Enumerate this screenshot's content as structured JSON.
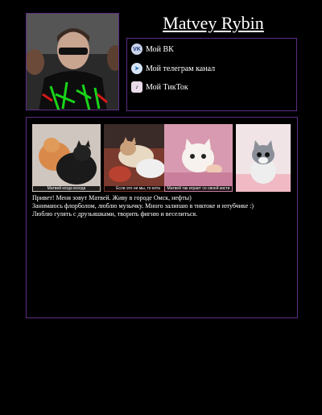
{
  "profile": {
    "name": "Matvey Rybin",
    "avatar_alt": "avatar"
  },
  "links": [
    {
      "label": "Мой ВК",
      "icon": "vk-icon",
      "glyph": "VK"
    },
    {
      "label": "Мой телеграм канал",
      "icon": "telegram-icon",
      "glyph": "➤"
    },
    {
      "label": "Мой ТикТок",
      "icon": "tiktok-icon",
      "glyph": "♪"
    }
  ],
  "gallery": [
    {
      "caption": "Матвей когда всегда"
    },
    {
      "caption": "Если это не мы, то кота"
    },
    {
      "caption": "Матвей так играет со своей кисти"
    },
    {
      "caption": ""
    }
  ],
  "bio": {
    "line1": "Привет! Меня зовут Матвей. Живу в городе Омск, нефты)",
    "line2": "Занимаюсь флорболом, люблю музычку. Много залипаю в тиктоке и ютубчике :)",
    "line3": "Люблю гулять с друзьяшками, творить фигню и веселиться."
  }
}
